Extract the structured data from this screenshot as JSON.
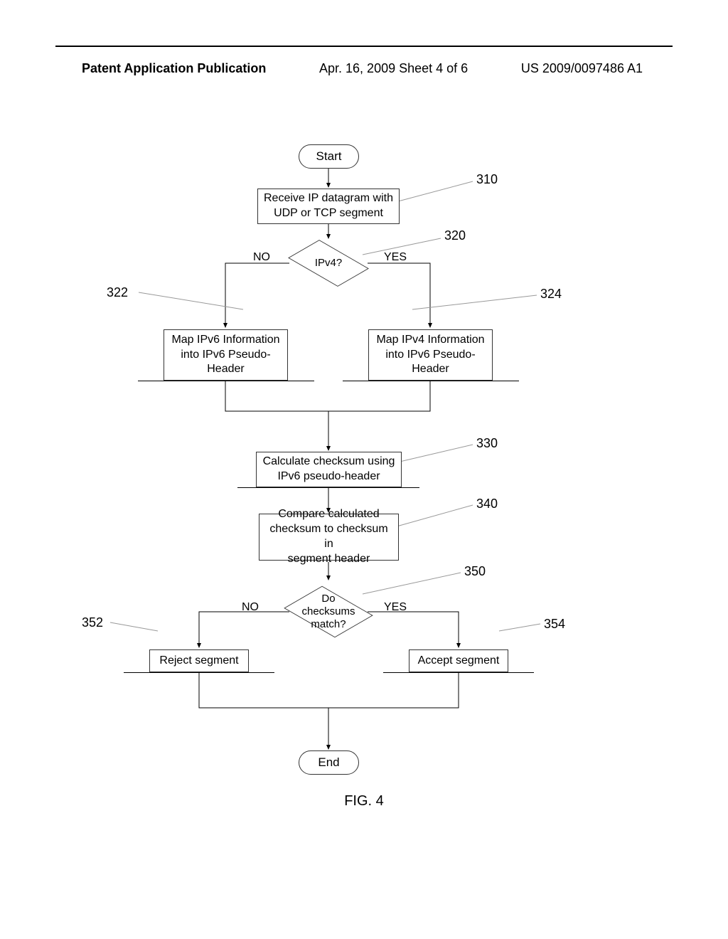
{
  "header": {
    "left": "Patent Application Publication",
    "center": "Apr. 16, 2009  Sheet 4 of 6",
    "right": "US 2009/0097486 A1"
  },
  "nodes": {
    "start": "Start",
    "receive": "Receive IP datagram with\nUDP or TCP segment",
    "ipv4_decision": "IPv4?",
    "map_ipv6": "Map IPv6 Information\ninto IPv6 Pseudo-\nHeader",
    "map_ipv4": "Map IPv4 Information\ninto IPv6 Pseudo-\nHeader",
    "calc_checksum": "Calculate checksum using\nIPv6 pseudo-header",
    "compare": "Compare calculated\nchecksum to checksum in\nsegment header",
    "checksums_decision": "Do\nchecksums\nmatch?",
    "reject": "Reject segment",
    "accept": "Accept segment",
    "end": "End"
  },
  "labels": {
    "no": "NO",
    "yes": "YES"
  },
  "refs": {
    "n310": "310",
    "n320": "320",
    "n322": "322",
    "n324": "324",
    "n330": "330",
    "n340": "340",
    "n350": "350",
    "n352": "352",
    "n354": "354"
  },
  "figure_label": "FIG. 4"
}
